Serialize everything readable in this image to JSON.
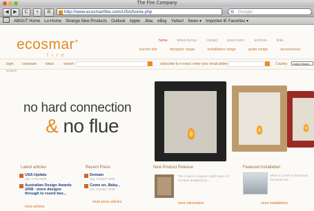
{
  "window": {
    "title": "The Fire Company"
  },
  "toolbar": {
    "back": "◀",
    "forward": "▶",
    "refresh": "C",
    "add": "+",
    "url": "http://www.ecosmartfire.com/USA/home.php",
    "search_placeholder": "Google"
  },
  "bookmarks": [
    "ABOUT Home",
    "Lo-Home",
    "Strange New Products",
    "Outlook",
    "Apple",
    ".Mac",
    "eBay",
    "Yahoo!",
    "News ▾",
    "Imported IE Favorites ▾"
  ],
  "site": {
    "logo_main": "ecosmar",
    "logo_plus": "+",
    "logo_sub": "fire",
    "top_nav": [
      "home",
      "where to buy",
      "contact",
      "press room",
      "archives",
      "links"
    ],
    "sub_nav": [
      "burner kits",
      "designer range",
      "installation range",
      "grate range",
      "accessories"
    ],
    "search_labels": [
      "login",
      "corporate",
      "ideas",
      "search"
    ],
    "newsletter_label": "subscribe to e-news: enter your email address here",
    "country_label": "Country",
    "country_value": "United States",
    "search_below": "location"
  },
  "hero": {
    "line1": "no hard connection",
    "amp": "&",
    "line2": "no flue"
  },
  "columns": {
    "latest_articles": {
      "heading": "Latest articles",
      "items": [
        {
          "title": "USA Update",
          "date": "Sat, 4 Oct 2008"
        },
        {
          "title": "Australian Design Awards 2008 - more designs through to round two...",
          "date": ""
        }
      ],
      "more": "more articles"
    },
    "recent_press": {
      "heading": "Recent Press",
      "items": [
        {
          "title": "Domain",
          "date": "Sat, October 2008"
        },
        {
          "title": "Come on, Baby...",
          "date": "Sat, October 2008"
        }
      ],
      "more": "more press articles"
    },
    "new_product": {
      "heading": "New Product Release",
      "body": "The Cube is a square stylish piece of furniture designed by ...",
      "more": "more information"
    },
    "featured": {
      "heading": "Featured Installation",
      "body": "When it comes to fireplaces, this particular...",
      "more": "more installations"
    }
  },
  "colors": {
    "brand_orange": "#e58a23",
    "accent_red": "#e0321c",
    "text_dark": "#3a3a3a"
  }
}
